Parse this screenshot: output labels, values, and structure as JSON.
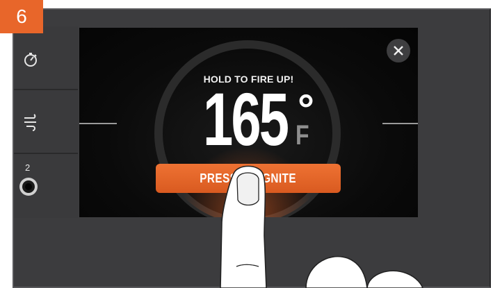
{
  "step": {
    "number": "6"
  },
  "side_menu": {
    "items": [
      {
        "icon": "timer-icon"
      },
      {
        "icon": "smoke-icon"
      },
      {
        "icon": "probe-jack-icon",
        "label": "2"
      }
    ]
  },
  "screen": {
    "prompt": "HOLD TO FIRE UP!",
    "temperature": "165",
    "degree_symbol": "°",
    "unit": "F",
    "button_label": "PRESS TO IGNITE",
    "close_icon": "close-icon"
  },
  "colors": {
    "accent": "#e8662a",
    "panel": "#3c3c3e",
    "screen": "#0a0a0a"
  }
}
